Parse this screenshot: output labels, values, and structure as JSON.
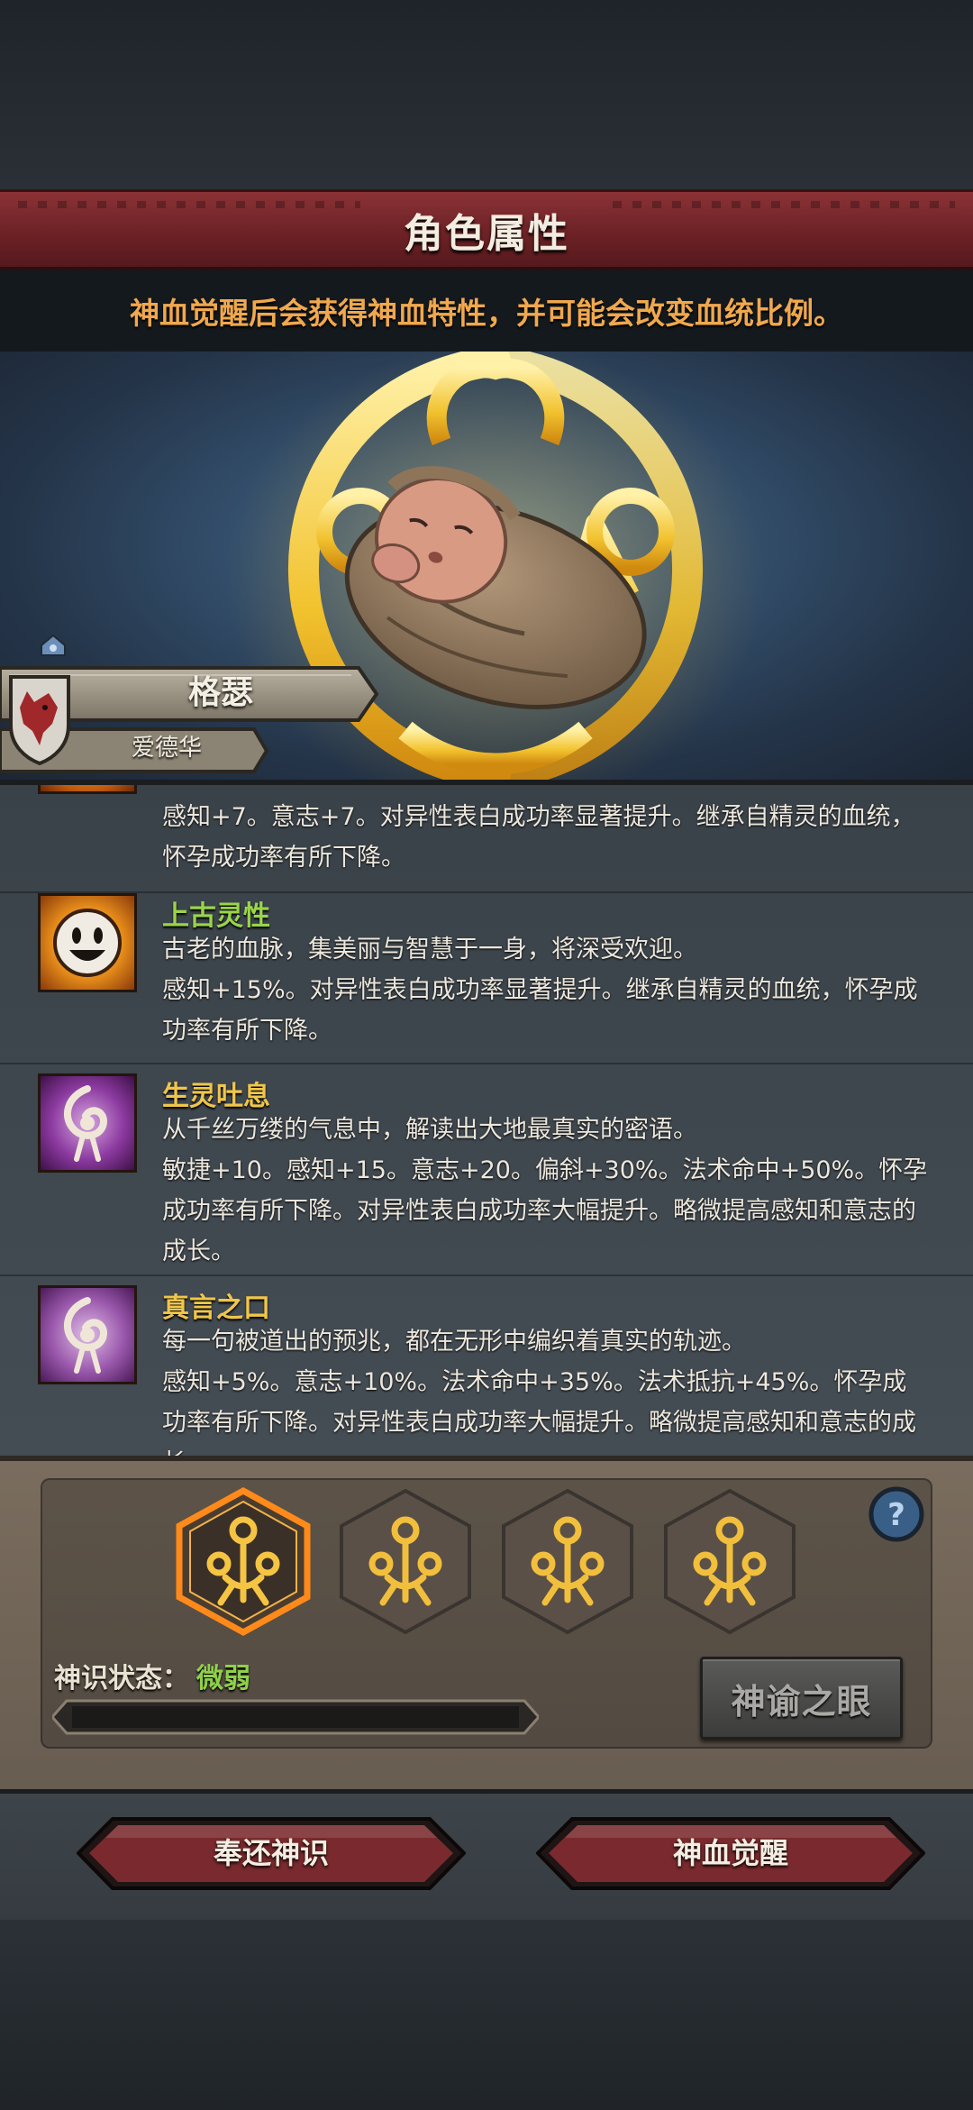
{
  "header": {
    "title": "角色属性",
    "hint": "神血觉醒后会获得神血特性，并可能会改变血统比例。"
  },
  "character": {
    "name": "格瑟",
    "subtitle": "爱德华"
  },
  "traits": [
    {
      "icon": "partial-trait-icon",
      "name": "",
      "lines": [
        "感知+7。意志+7。对异性表白成功率显著提升。继承自精灵的血统，",
        "怀孕成功率有所下降。"
      ]
    },
    {
      "icon": "smiling-face-icon",
      "name": "上古灵性",
      "name_color": "#9ad44a",
      "lines": [
        "古老的血脉，集美丽与智慧于一身，将深受欢迎。",
        "感知+15%。对异性表白成功率显著提升。继承自精灵的血统，怀孕成",
        "功率有所下降。"
      ]
    },
    {
      "icon": "spirit-swirl-icon",
      "name": "生灵吐息",
      "name_color": "#f0c64a",
      "lines": [
        "从千丝万缕的气息中，解读出大地最真实的密语。",
        "敏捷+10。感知+15。意志+20。偏斜+30%。法术命中+50%。怀孕",
        "成功率有所下降。对异性表白成功率大幅提升。略微提高感知和意志的",
        "成长。"
      ]
    },
    {
      "icon": "spirit-swirl-icon",
      "name": "真言之口",
      "name_color": "#f0c64a",
      "lines": [
        "每一句被道出的预兆，都在无形中编织着真实的轨迹。",
        "感知+5%。意志+10%。法术命中+35%。法术抵抗+45%。怀孕成",
        "功率有所下降。对异性表白成功率大幅提升。略微提高感知和意志的成",
        "长。"
      ]
    }
  ],
  "divine": {
    "slots": [
      {
        "icon": "divine-emblem-icon",
        "selected": true
      },
      {
        "icon": "divine-emblem-icon",
        "selected": false
      },
      {
        "icon": "divine-emblem-icon",
        "selected": false
      },
      {
        "icon": "divine-emblem-icon",
        "selected": false
      }
    ],
    "state_label": "神识状态：",
    "state_value": "微弱",
    "state_color": "#8ed04a",
    "progress": 0,
    "oracle_button": "神谕之眼",
    "help_icon": "question-mark-icon"
  },
  "actions": {
    "return_button": "奉还神识",
    "awaken_button": "神血觉醒"
  },
  "colors": {
    "title_banner": "#6d2226",
    "hint_text": "#f0a84e",
    "trait_name_gold": "#f0c64a",
    "trait_name_green": "#9ad44a",
    "action_button": "#7a2a2e"
  }
}
